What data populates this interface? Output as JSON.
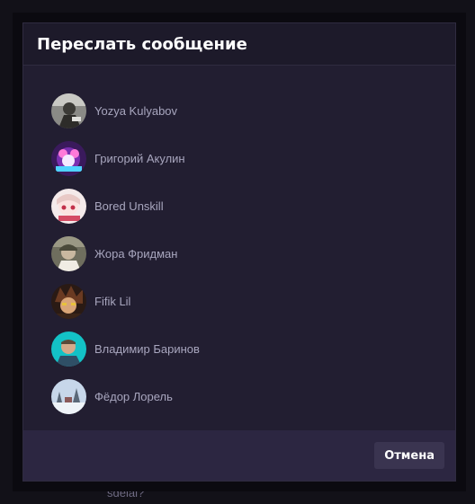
{
  "background": {
    "partial_text": "sdelal?"
  },
  "modal": {
    "title": "Переслать сообщение",
    "contacts": [
      {
        "name": "Yozya Kulyabov",
        "avatar": "avatar-photo-gray"
      },
      {
        "name": "Григорий Акулин",
        "avatar": "avatar-anime-purple"
      },
      {
        "name": "Bored Unskill",
        "avatar": "avatar-anime-pink"
      },
      {
        "name": "Жора Фридман",
        "avatar": "avatar-photo-olive"
      },
      {
        "name": "Fifik Lil",
        "avatar": "avatar-anime-dark"
      },
      {
        "name": "Владимир Баринов",
        "avatar": "avatar-photo-cyan"
      },
      {
        "name": "Фёдор Лорель",
        "avatar": "avatar-photo-winter"
      }
    ],
    "cancel_label": "Отмена"
  },
  "colors": {
    "modal_bg": "#221e31",
    "header_bg": "#1d1a2a",
    "footer_bg": "#2c2641",
    "button_bg": "#3a3450",
    "name_text": "#a8a6be"
  }
}
